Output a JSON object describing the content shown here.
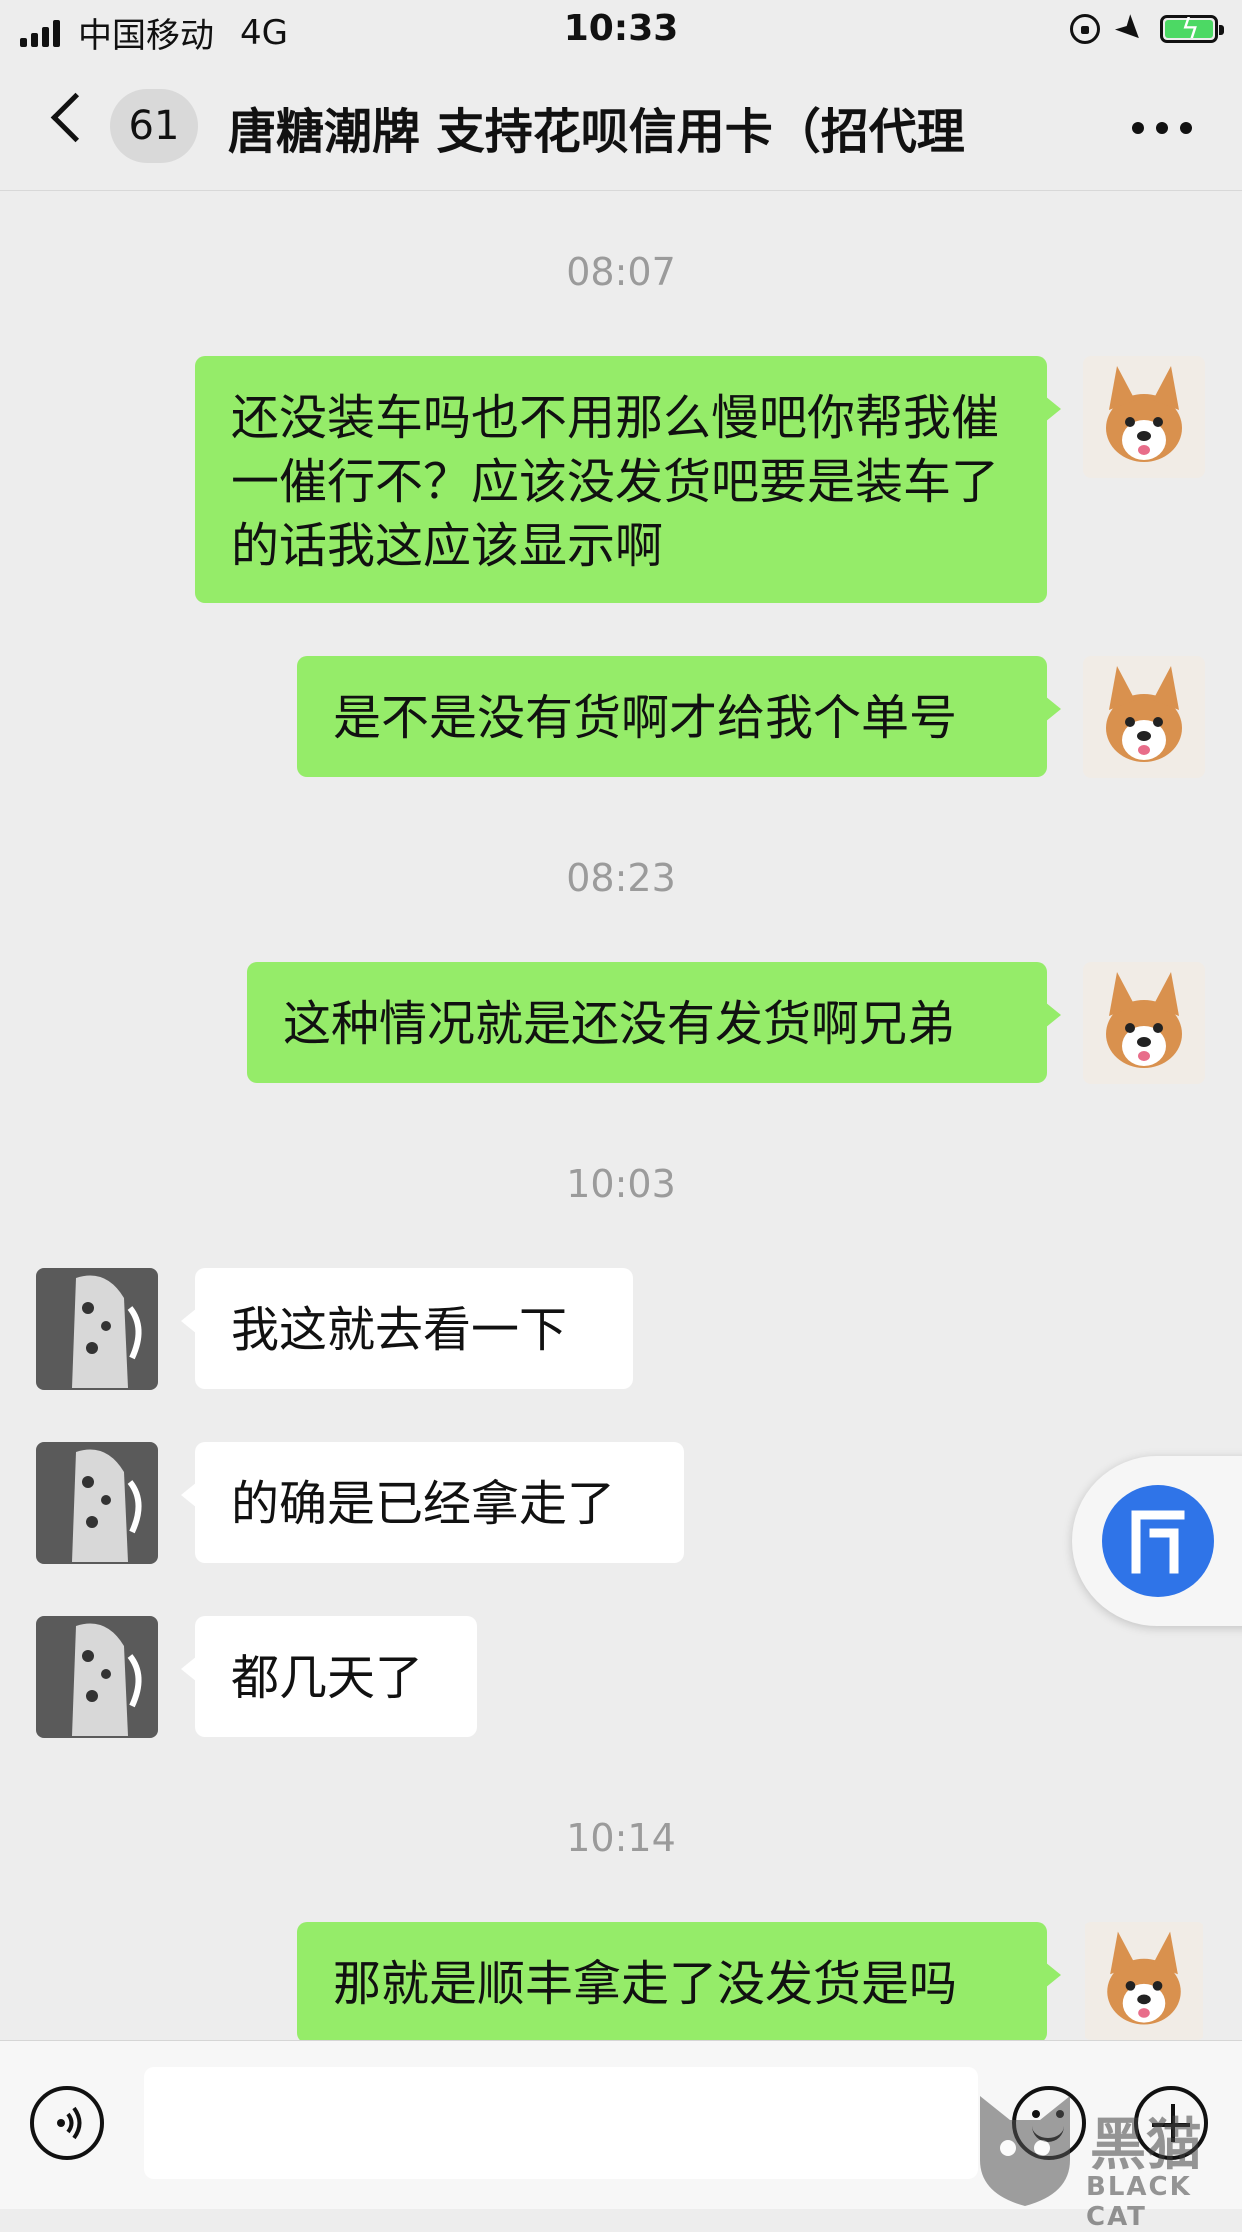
{
  "status_bar": {
    "carrier": "中国移动",
    "network": "4G",
    "time": "10:33",
    "icons": [
      "signal-icon",
      "rotation-lock-icon",
      "location-arrow-icon",
      "battery-charging-icon"
    ]
  },
  "nav": {
    "unread_count": "61",
    "title": "唐糖潮牌 支持花呗信用卡（招代理",
    "icons": [
      "back-chevron-icon",
      "more-icon"
    ]
  },
  "messages": [
    {
      "type": "time",
      "text": "08:07"
    },
    {
      "type": "sent",
      "text": "还没装车吗也不用那么慢吧你帮我催一催行不？应该没发货吧要是装车了的话我这应该显示啊"
    },
    {
      "type": "sent",
      "text": "是不是没有货啊才给我个单号"
    },
    {
      "type": "time",
      "text": "08:23"
    },
    {
      "type": "sent",
      "text": "这种情况就是还没有发货啊兄弟"
    },
    {
      "type": "time",
      "text": "10:03"
    },
    {
      "type": "received",
      "text": "我这就去看一下"
    },
    {
      "type": "received",
      "text": "的确是已经拿走了"
    },
    {
      "type": "received",
      "text": "都几天了"
    },
    {
      "type": "time",
      "text": "10:14"
    },
    {
      "type": "sent",
      "text": "那就是顺丰拿走了没发货是吗"
    }
  ],
  "input_bar": {
    "placeholder": "",
    "icons": [
      "voice-icon",
      "emoji-icon",
      "plus-icon"
    ]
  },
  "floating_button": {
    "icon": "floating-app-icon",
    "color": "#2f74e8"
  },
  "watermark": {
    "text": "黑猫",
    "subtext": "BLACK CAT"
  },
  "colors": {
    "sent_bubble": "#95ec69",
    "received_bubble": "#ffffff",
    "background": "#ededed"
  }
}
